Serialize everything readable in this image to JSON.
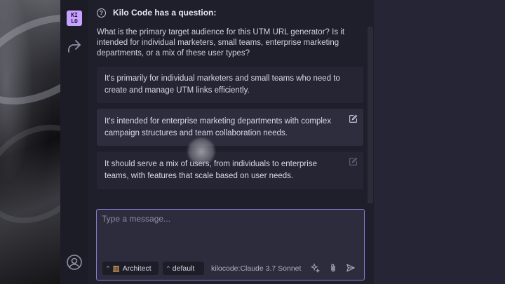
{
  "header": {
    "title": "Kilo Code has a question:"
  },
  "logo": {
    "text": "KILO"
  },
  "question": "What is the primary target audience for this UTM URL generator? Is it intended for individual marketers, small teams, enterprise marketing departments, or a mix of these user types?",
  "options": [
    {
      "text": "It's primarily for individual marketers and small teams who need to create and manage UTM links efficiently."
    },
    {
      "text": "It's intended for enterprise marketing departments with complex campaign structures and team collaboration needs."
    },
    {
      "text": "It should serve a mix of users, from individuals to enterprise teams, with features that scale based on user needs."
    }
  ],
  "input": {
    "placeholder": "Type a message...",
    "value": ""
  },
  "toolbar": {
    "mode_label": "Architect",
    "profile_label": "default",
    "model_label": "kilocode:Claude 3.7 Sonnet"
  },
  "colors": {
    "accent": "#c7a2ff",
    "border_focus": "#8a7ad6",
    "panel": "#1f1f2b"
  }
}
